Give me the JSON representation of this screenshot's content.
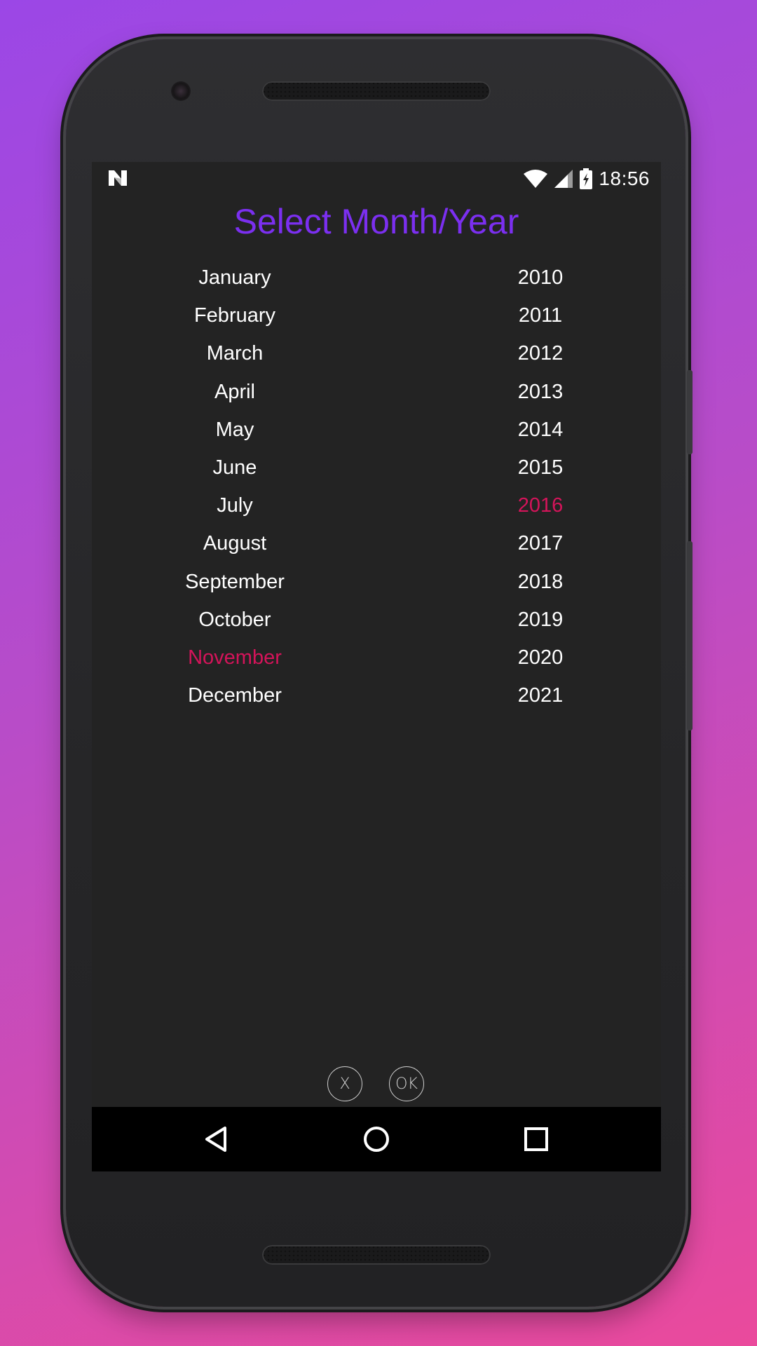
{
  "status_bar": {
    "time": "18:56",
    "icons": [
      "n-logo-icon",
      "wifi-icon",
      "signal-icon",
      "battery-charging-icon"
    ]
  },
  "dialog": {
    "title": "Select Month/Year",
    "months": [
      {
        "label": "January",
        "selected": false
      },
      {
        "label": "February",
        "selected": false
      },
      {
        "label": "March",
        "selected": false
      },
      {
        "label": "April",
        "selected": false
      },
      {
        "label": "May",
        "selected": false
      },
      {
        "label": "June",
        "selected": false
      },
      {
        "label": "July",
        "selected": false
      },
      {
        "label": "August",
        "selected": false
      },
      {
        "label": "September",
        "selected": false
      },
      {
        "label": "October",
        "selected": false
      },
      {
        "label": "November",
        "selected": true
      },
      {
        "label": "December",
        "selected": false
      }
    ],
    "years": [
      {
        "label": "2010",
        "selected": false
      },
      {
        "label": "2011",
        "selected": false
      },
      {
        "label": "2012",
        "selected": false
      },
      {
        "label": "2013",
        "selected": false
      },
      {
        "label": "2014",
        "selected": false
      },
      {
        "label": "2015",
        "selected": false
      },
      {
        "label": "2016",
        "selected": true
      },
      {
        "label": "2017",
        "selected": false
      },
      {
        "label": "2018",
        "selected": false
      },
      {
        "label": "2019",
        "selected": false
      },
      {
        "label": "2020",
        "selected": false
      },
      {
        "label": "2021",
        "selected": false
      }
    ],
    "cancel_label": "X",
    "ok_label": "OK"
  },
  "nav_bar": {
    "icons": [
      "back-icon",
      "home-icon",
      "recents-icon"
    ]
  },
  "colors": {
    "title": "#7b2ff0",
    "selected": "#d4145a",
    "screen_bg": "#232323",
    "text": "#ffffff"
  }
}
